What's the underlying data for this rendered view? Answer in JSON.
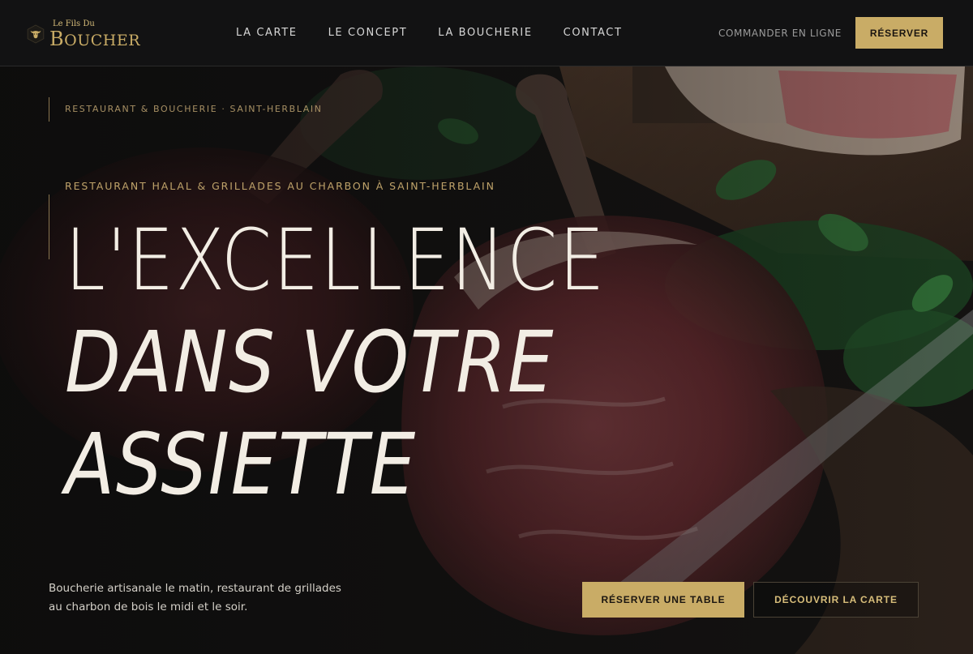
{
  "brand": {
    "logo_small": "Le Fils Du",
    "logo_big_initial": "B",
    "logo_big_rest": "OUCHER",
    "icon": "bull-head-icon",
    "gold": "#c9ac66"
  },
  "nav": {
    "items": [
      "LA CARTE",
      "LE CONCEPT",
      "LA BOUCHERIE",
      "CONTACT"
    ],
    "order_online": "COMMANDER EN LIGNE",
    "reserve": "RÉSERVER"
  },
  "hero": {
    "breadcrumb": "RESTAURANT & BOUCHERIE · SAINT-HERBLAIN",
    "kicker": "RESTAURANT HALAL & GRILLADES AU CHARBON À SAINT-HERBLAIN",
    "title_line1": "L'EXCELLENCE",
    "title_line2": "DANS VOTRE",
    "title_line3": "ASSIETTE",
    "description": "Boucherie artisanale le matin, restaurant de grillades au charbon de bois le midi et le soir.",
    "cta_primary": "RÉSERVER UNE TABLE",
    "cta_secondary": "DÉCOUVRIR LA CARTE"
  }
}
